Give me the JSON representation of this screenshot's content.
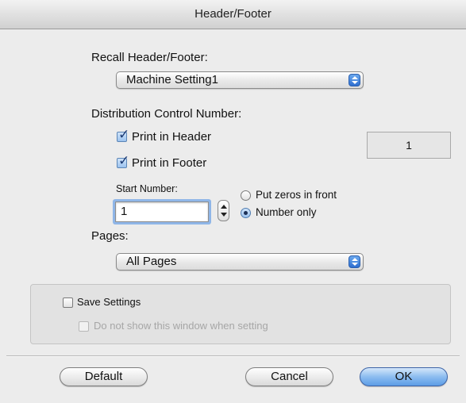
{
  "window": {
    "title": "Header/Footer"
  },
  "recall": {
    "label": "Recall Header/Footer:",
    "selected": "Machine Setting1"
  },
  "distribution": {
    "label": "Distribution Control Number:",
    "print_header": {
      "label": "Print in Header",
      "checked": true
    },
    "print_footer": {
      "label": "Print in Footer",
      "checked": true
    },
    "display_value": "1",
    "start_number": {
      "label": "Start Number:",
      "value": "1"
    },
    "radio_zeros": {
      "label": "Put zeros in front",
      "selected": false
    },
    "radio_number_only": {
      "label": "Number only",
      "selected": true
    }
  },
  "pages": {
    "label": "Pages:",
    "selected": "All Pages"
  },
  "settings": {
    "save_label": "Save Settings",
    "dont_show_label": "Do not show this window when setting"
  },
  "buttons": {
    "default": "Default",
    "cancel": "Cancel",
    "ok": "OK"
  },
  "colors": {
    "accent": "#5d9de6",
    "window_bg": "#ececec"
  }
}
